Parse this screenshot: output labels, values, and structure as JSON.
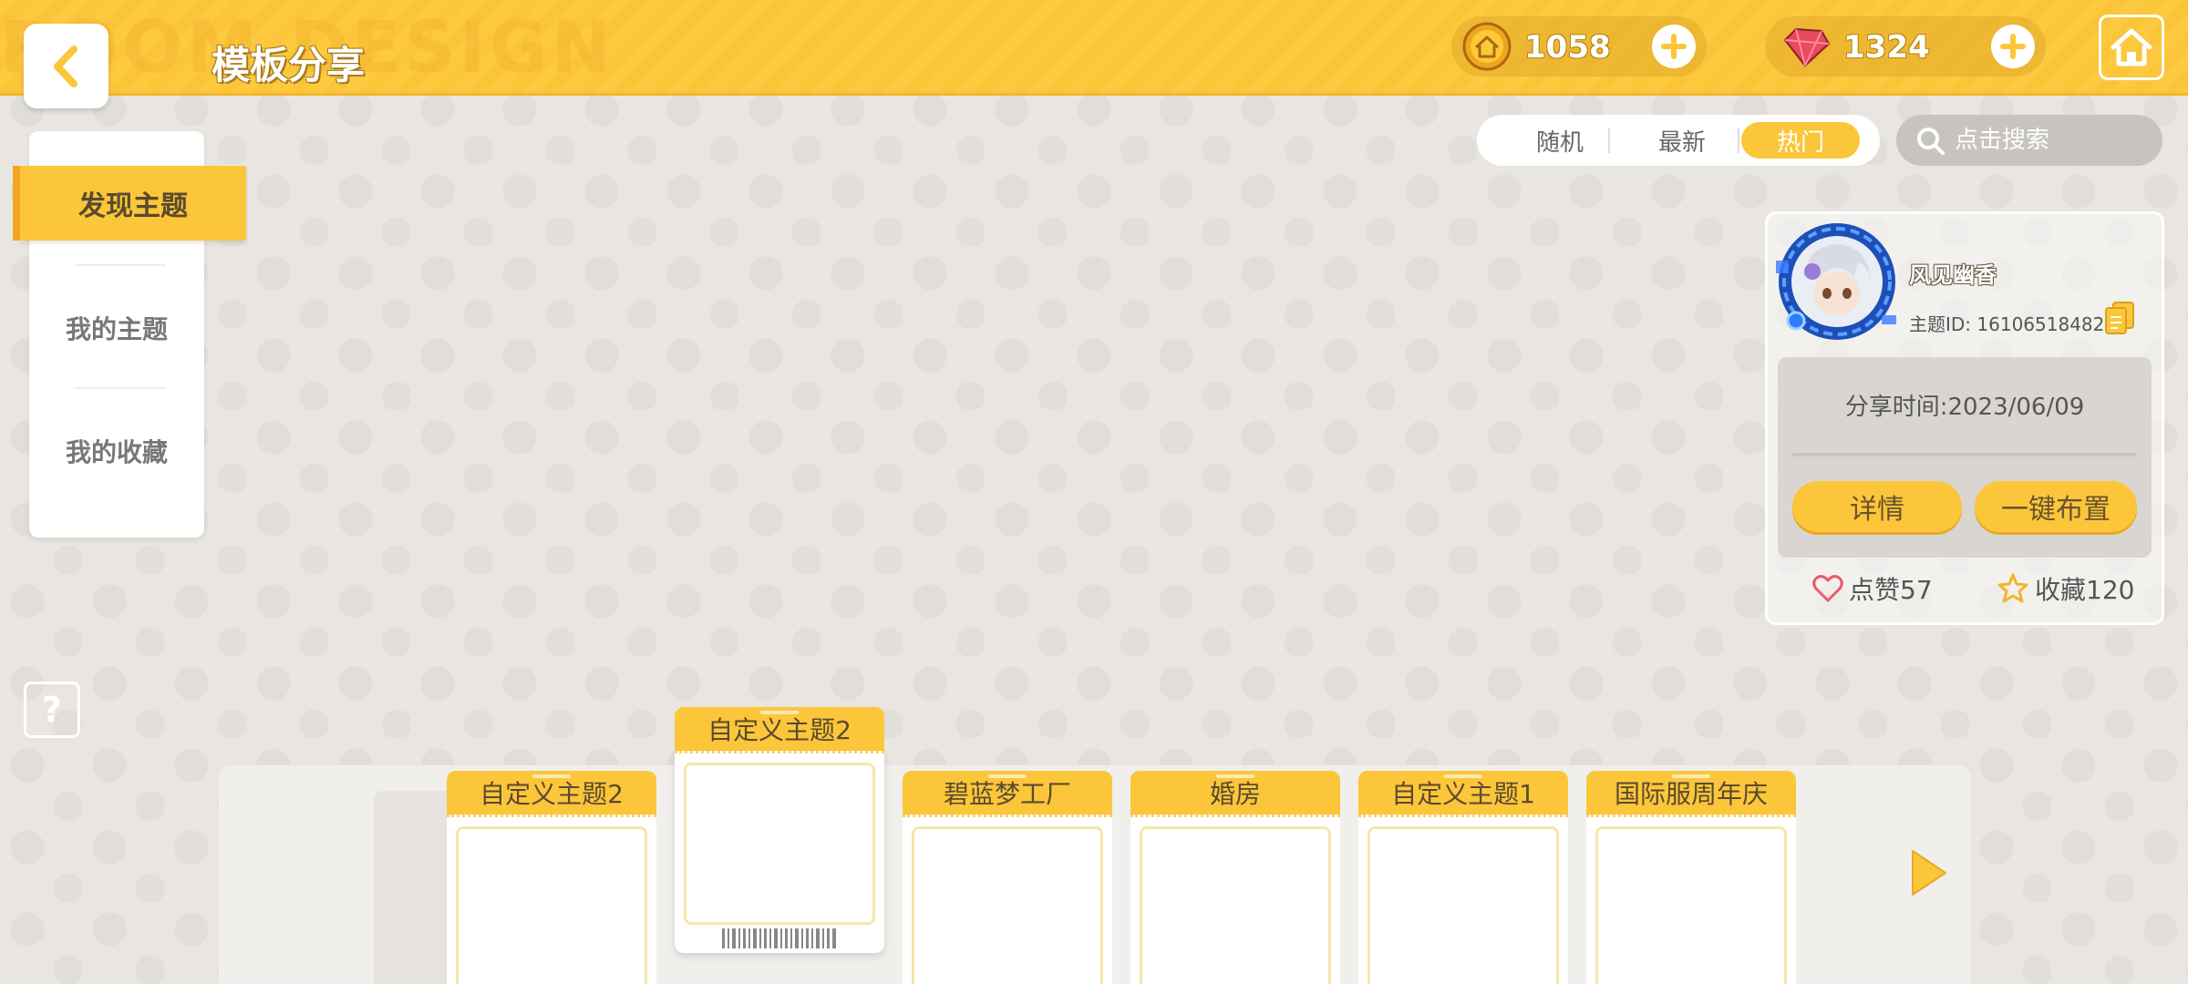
{
  "topbar": {
    "title": "模板分享",
    "currency": [
      {
        "name": "coin",
        "value": "1058",
        "icon": "coin-house-icon"
      },
      {
        "name": "gem",
        "value": "1324",
        "icon": "red-gem-icon"
      }
    ]
  },
  "filters": {
    "tabs": [
      "随机",
      "最新",
      "热门"
    ],
    "active": "热门"
  },
  "search": {
    "placeholder": "点击搜索"
  },
  "nav": {
    "items": [
      {
        "label": "发现主题",
        "active": true
      },
      {
        "label": "我的主题",
        "active": false
      },
      {
        "label": "我的收藏",
        "active": false
      }
    ]
  },
  "help": {
    "label": "?"
  },
  "theme_card": {
    "author": "风见幽香",
    "theme_id": "主题ID: 16106518482",
    "share_time": "分享时间:2023/06/09",
    "detail_button": "详情",
    "apply_button": "一键布置",
    "likes": "点赞57",
    "favorites": "收藏120"
  },
  "carousel": {
    "themes": [
      {
        "name": "自定义主题2",
        "selected": false
      },
      {
        "name": "自定义主题2",
        "selected": true
      },
      {
        "name": "碧蓝梦工厂",
        "selected": false
      },
      {
        "name": "婚房",
        "selected": false
      },
      {
        "name": "自定义主题1",
        "selected": false
      },
      {
        "name": "国际服周年庆",
        "selected": false
      }
    ]
  },
  "colors": {
    "accent": "#fcc63a",
    "background": "#e9e6e1",
    "topbar": "#fcc93f"
  }
}
